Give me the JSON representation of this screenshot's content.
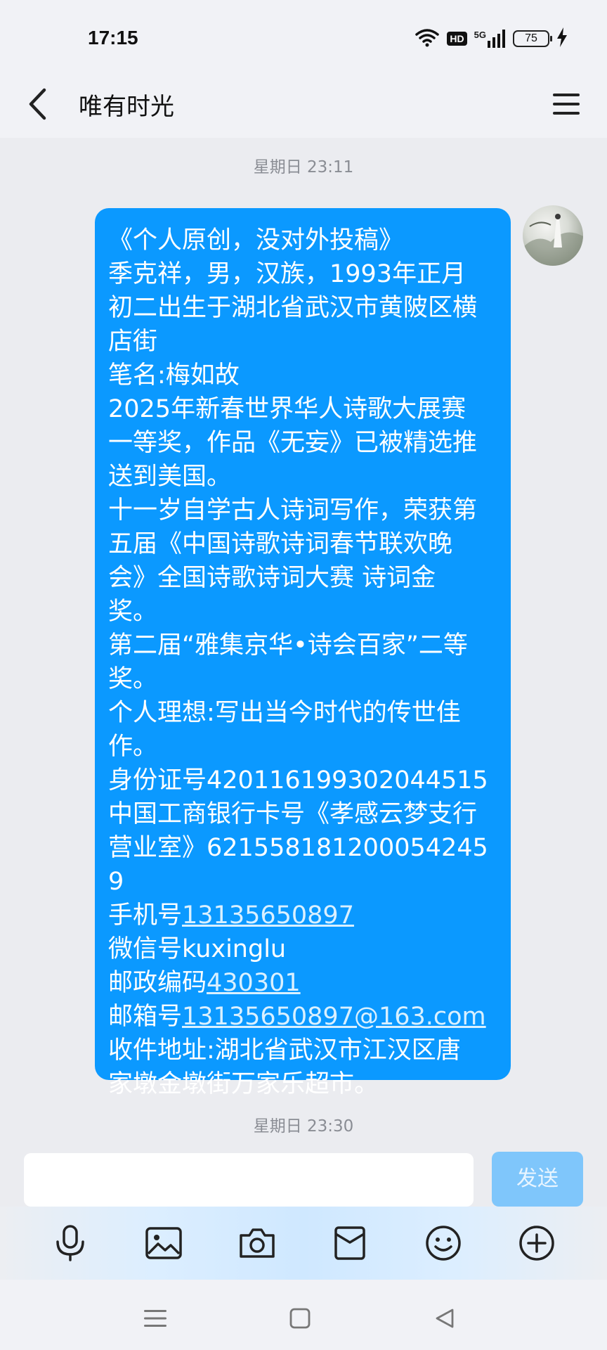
{
  "status_bar": {
    "time": "17:15",
    "battery": "75",
    "network": "5G",
    "hd_label": "HD",
    "icons": [
      "wifi-icon",
      "hd-icon",
      "signal-5g-icon",
      "battery-icon",
      "charging-icon"
    ]
  },
  "header": {
    "title": "唯有时光",
    "back_icon": "back-arrow-icon",
    "menu_icon": "menu-icon"
  },
  "chat": {
    "timestamps": [
      "星期日 23:11",
      "星期日 23:30"
    ],
    "message_lines": [
      "《个人原创，没对外投稿》",
      "季克祥，男，汉族，1993年正月",
      "初二出生于湖北省武汉市黄陂区横",
      "店街",
      "笔名:梅如故",
      "2025年新春世界华人诗歌大展赛",
      "一等奖，作品《无妄》已被精选推",
      "送到美国。",
      "十一岁自学古人诗词写作，荣获第",
      "五届《中国诗歌诗词春节联欢晚",
      "会》全国诗歌诗词大赛 诗词金",
      "奖。",
      "第二届“雅集京华•诗会百家”二等",
      "奖。",
      "个人理想:写出当今时代的传世佳",
      "作。",
      "身份证号420116199302044515",
      "中国工商银行卡号《孝感云梦支行",
      "营业室》6215581812000542459"
    ],
    "phone_label": "手机号",
    "phone_value": "13135650897",
    "wechat_line": "微信号kuxinglu",
    "postcode_label": "邮政编码",
    "postcode_value": "430301",
    "email_label": "邮箱号",
    "email_value": "13135650897@163.com",
    "address_lines": [
      "收件地址:湖北省武汉市江汉区唐",
      "家墩金墩街万家乐超市。"
    ],
    "bubble_color": "#0b99ff"
  },
  "input": {
    "value": "",
    "placeholder": "",
    "send_label": "发送"
  },
  "toolbar": {
    "icons": [
      "microphone-icon",
      "image-icon",
      "camera-icon",
      "red-packet-icon",
      "emoji-icon",
      "plus-icon"
    ]
  },
  "navbar": {
    "icons": [
      "recent-apps-icon",
      "home-icon",
      "back-icon"
    ]
  }
}
